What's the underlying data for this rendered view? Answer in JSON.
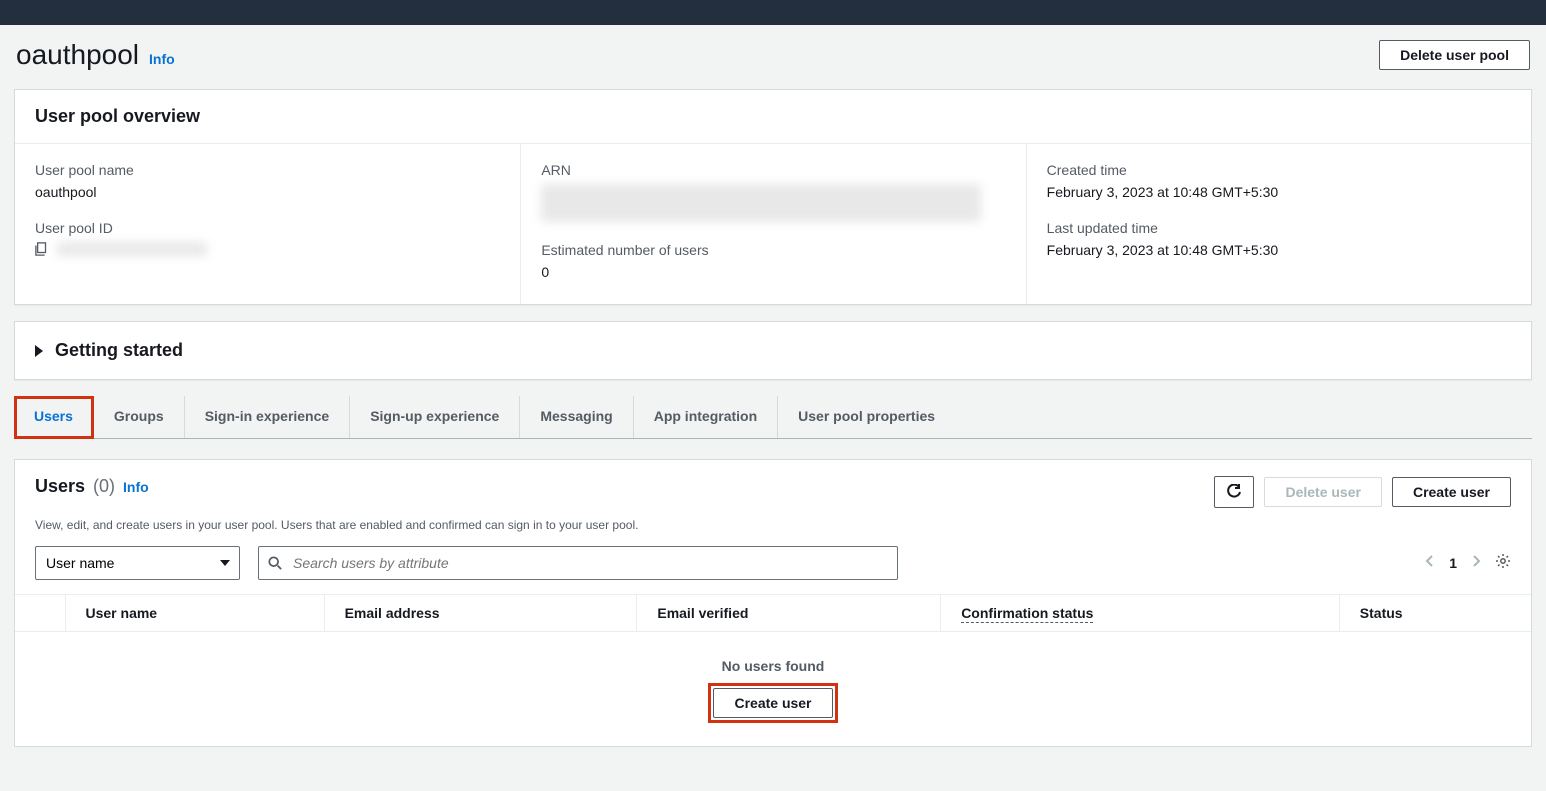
{
  "header": {
    "title": "oauthpool",
    "info": "Info",
    "delete_btn": "Delete user pool"
  },
  "overview": {
    "title": "User pool overview",
    "col1": {
      "name_label": "User pool name",
      "name_value": "oauthpool",
      "id_label": "User pool ID"
    },
    "col2": {
      "arn_label": "ARN",
      "users_label": "Estimated number of users",
      "users_value": "0"
    },
    "col3": {
      "created_label": "Created time",
      "created_value": "February 3, 2023 at 10:48 GMT+5:30",
      "updated_label": "Last updated time",
      "updated_value": "February 3, 2023 at 10:48 GMT+5:30"
    }
  },
  "getting_started": "Getting started",
  "tabs": {
    "users": "Users",
    "groups": "Groups",
    "signin": "Sign-in experience",
    "signup": "Sign-up experience",
    "messaging": "Messaging",
    "app_integration": "App integration",
    "properties": "User pool properties"
  },
  "users_section": {
    "title": "Users",
    "count": "(0)",
    "info": "Info",
    "desc": "View, edit, and create users in your user pool. Users that are enabled and confirmed can sign in to your user pool.",
    "refresh": "Refresh",
    "delete_user": "Delete user",
    "create_user": "Create user",
    "attr_select": "User name",
    "search_placeholder": "Search users by attribute",
    "page": "1",
    "columns": {
      "username": "User name",
      "email": "Email address",
      "email_verified": "Email verified",
      "confirmation": "Confirmation status",
      "status": "Status"
    },
    "empty": "No users found",
    "empty_btn": "Create user"
  }
}
